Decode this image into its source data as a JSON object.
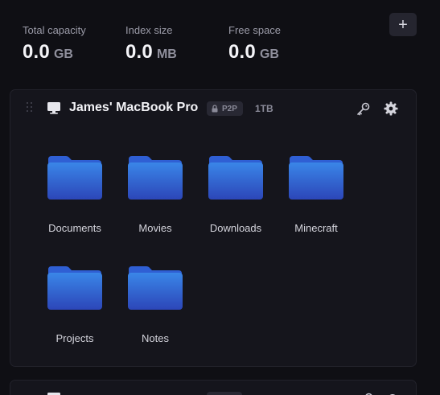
{
  "stats": [
    {
      "label": "Total capacity",
      "value": "0.0",
      "unit": "GB"
    },
    {
      "label": "Index size",
      "value": "0.0",
      "unit": "MB"
    },
    {
      "label": "Free space",
      "value": "0.0",
      "unit": "GB"
    }
  ],
  "add_button": {
    "label": "+"
  },
  "device": {
    "name": "James' MacBook Pro",
    "badge": "P2P",
    "capacity": "1TB",
    "icons": [
      "drag-handle-icon",
      "laptop-icon",
      "lock-icon",
      "key-icon",
      "gear-icon"
    ]
  },
  "folders": [
    {
      "label": "Documents"
    },
    {
      "label": "Movies"
    },
    {
      "label": "Downloads"
    },
    {
      "label": "Minecraft"
    },
    {
      "label": "Projects"
    },
    {
      "label": "Notes"
    }
  ],
  "colors": {
    "background": "#0f0f14",
    "card": "#15151c",
    "folder_top": "#3a86e8",
    "folder_bottom": "#2c46b8"
  }
}
